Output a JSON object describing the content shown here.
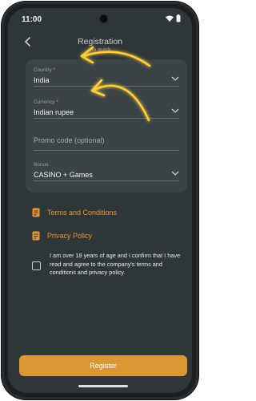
{
  "status": {
    "time": "11:00"
  },
  "header": {
    "title": "Registration",
    "subtitle": "via quick"
  },
  "form": {
    "country": {
      "label": "Country",
      "required": "*",
      "value": "India"
    },
    "currency": {
      "label": "Currency",
      "required": "*",
      "value": "Indian rupee"
    },
    "promo": {
      "placeholder": "Promo code (optional)"
    },
    "bonus": {
      "label": "Bonus",
      "value": "CASINO + Games"
    }
  },
  "links": {
    "terms": "Terms and Conditions",
    "privacy": "Privacy Policy"
  },
  "consent": "I am over 18 years of age and I confirm that I have read and agree to the company's terms and conditions and privacy policy.",
  "register_label": "Register",
  "colors": {
    "accent": "#e2953f",
    "button": "#d99634",
    "background": "#2f3638",
    "card": "#3b4346",
    "arrow_glow": "#ffcf3a"
  },
  "icons": [
    "back-arrow-icon",
    "chevron-down-icon",
    "document-icon",
    "wifi-icon",
    "battery-icon",
    "camera-icon"
  ]
}
